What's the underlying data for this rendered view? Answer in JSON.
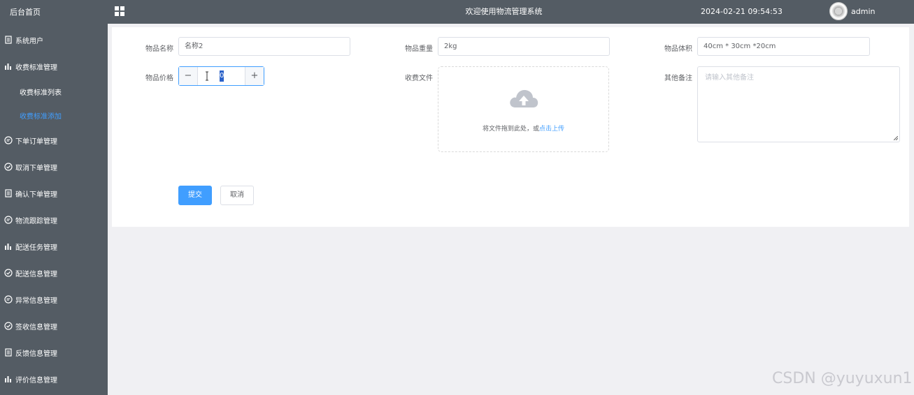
{
  "sidebar": {
    "home": "后台首页",
    "items": [
      {
        "label": "系统用户",
        "icon": "document-icon"
      },
      {
        "label": "收费标准管理",
        "icon": "bar-chart-icon"
      },
      {
        "label": "下单订单管理",
        "icon": "chat-icon"
      },
      {
        "label": "取消下单管理",
        "icon": "check-circle-icon"
      },
      {
        "label": "确认下单管理",
        "icon": "document-icon"
      },
      {
        "label": "物流跟踪管理",
        "icon": "chat-icon"
      },
      {
        "label": "配送任务管理",
        "icon": "bar-chart-icon"
      },
      {
        "label": "配送信息管理",
        "icon": "check-circle-icon"
      },
      {
        "label": "异常信息管理",
        "icon": "chat-icon"
      },
      {
        "label": "签收信息管理",
        "icon": "check-circle-icon"
      },
      {
        "label": "反馈信息管理",
        "icon": "document-icon"
      },
      {
        "label": "评价信息管理",
        "icon": "bar-chart-icon"
      }
    ],
    "subitems": [
      {
        "label": "收费标准列表"
      },
      {
        "label": "收费标准添加"
      }
    ]
  },
  "header": {
    "title": "欢迎使用物流管理系统",
    "datetime": "2024-02-21 09:54:53",
    "user": "admin"
  },
  "form": {
    "name_label": "物品名称",
    "name_value": "名称2",
    "weight_label": "物品重量",
    "weight_value": "2kg",
    "volume_label": "物品体积",
    "volume_value": "40cm * 30cm *20cm",
    "price_label": "物品价格",
    "price_value": "0",
    "minus": "−",
    "plus": "+",
    "file_label": "收费文件",
    "upload_text": "将文件拖到此处，或",
    "upload_link": "点击上传",
    "remark_label": "其他备注",
    "remark_placeholder": "请输入其他备注",
    "submit": "提交",
    "cancel": "取消"
  },
  "watermark": "CSDN @yuyuxun1",
  "colors": {
    "sidebar_bg": "#545c64",
    "accent": "#409eff"
  }
}
